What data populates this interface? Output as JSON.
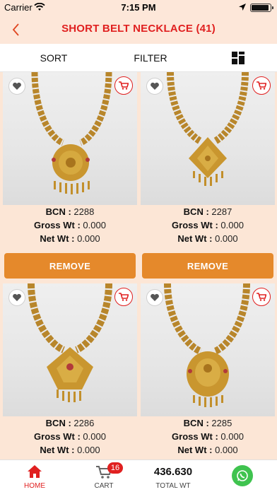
{
  "status_bar": {
    "carrier": "Carrier",
    "time": "7:15 PM"
  },
  "nav": {
    "title": "SHORT BELT NECKLACE (41)"
  },
  "toolbar": {
    "sort_label": "SORT",
    "filter_label": "FILTER"
  },
  "products": [
    {
      "bcn_label": "BCN :",
      "bcn": "2288",
      "gross_label": "Gross Wt :",
      "gross": "0.000",
      "net_label": "Net Wt :",
      "net": "0.000",
      "button": "REMOVE"
    },
    {
      "bcn_label": "BCN :",
      "bcn": "2287",
      "gross_label": "Gross Wt :",
      "gross": "0.000",
      "net_label": "Net Wt :",
      "net": "0.000",
      "button": "REMOVE"
    },
    {
      "bcn_label": "BCN :",
      "bcn": "2286",
      "gross_label": "Gross Wt :",
      "gross": "0.000",
      "net_label": "Net Wt :",
      "net": "0.000"
    },
    {
      "bcn_label": "BCN :",
      "bcn": "2285",
      "gross_label": "Gross Wt :",
      "gross": "0.000",
      "net_label": "Net Wt :",
      "net": "0.000"
    }
  ],
  "tabbar": {
    "home_label": "HOME",
    "cart_label": "CART",
    "cart_count": "16",
    "total_value": "436.630",
    "total_label": "TOTAL WT"
  },
  "colors": {
    "accent": "#e02020",
    "remove_button": "#e5892b",
    "background": "#fce6d6",
    "whatsapp": "#3fc34f"
  },
  "icons": [
    "wifi-icon",
    "location-arrow-icon",
    "battery-icon",
    "back-chevron-icon",
    "grid-view-icon",
    "heart-icon",
    "cart-icon",
    "home-icon",
    "whatsapp-icon"
  ]
}
